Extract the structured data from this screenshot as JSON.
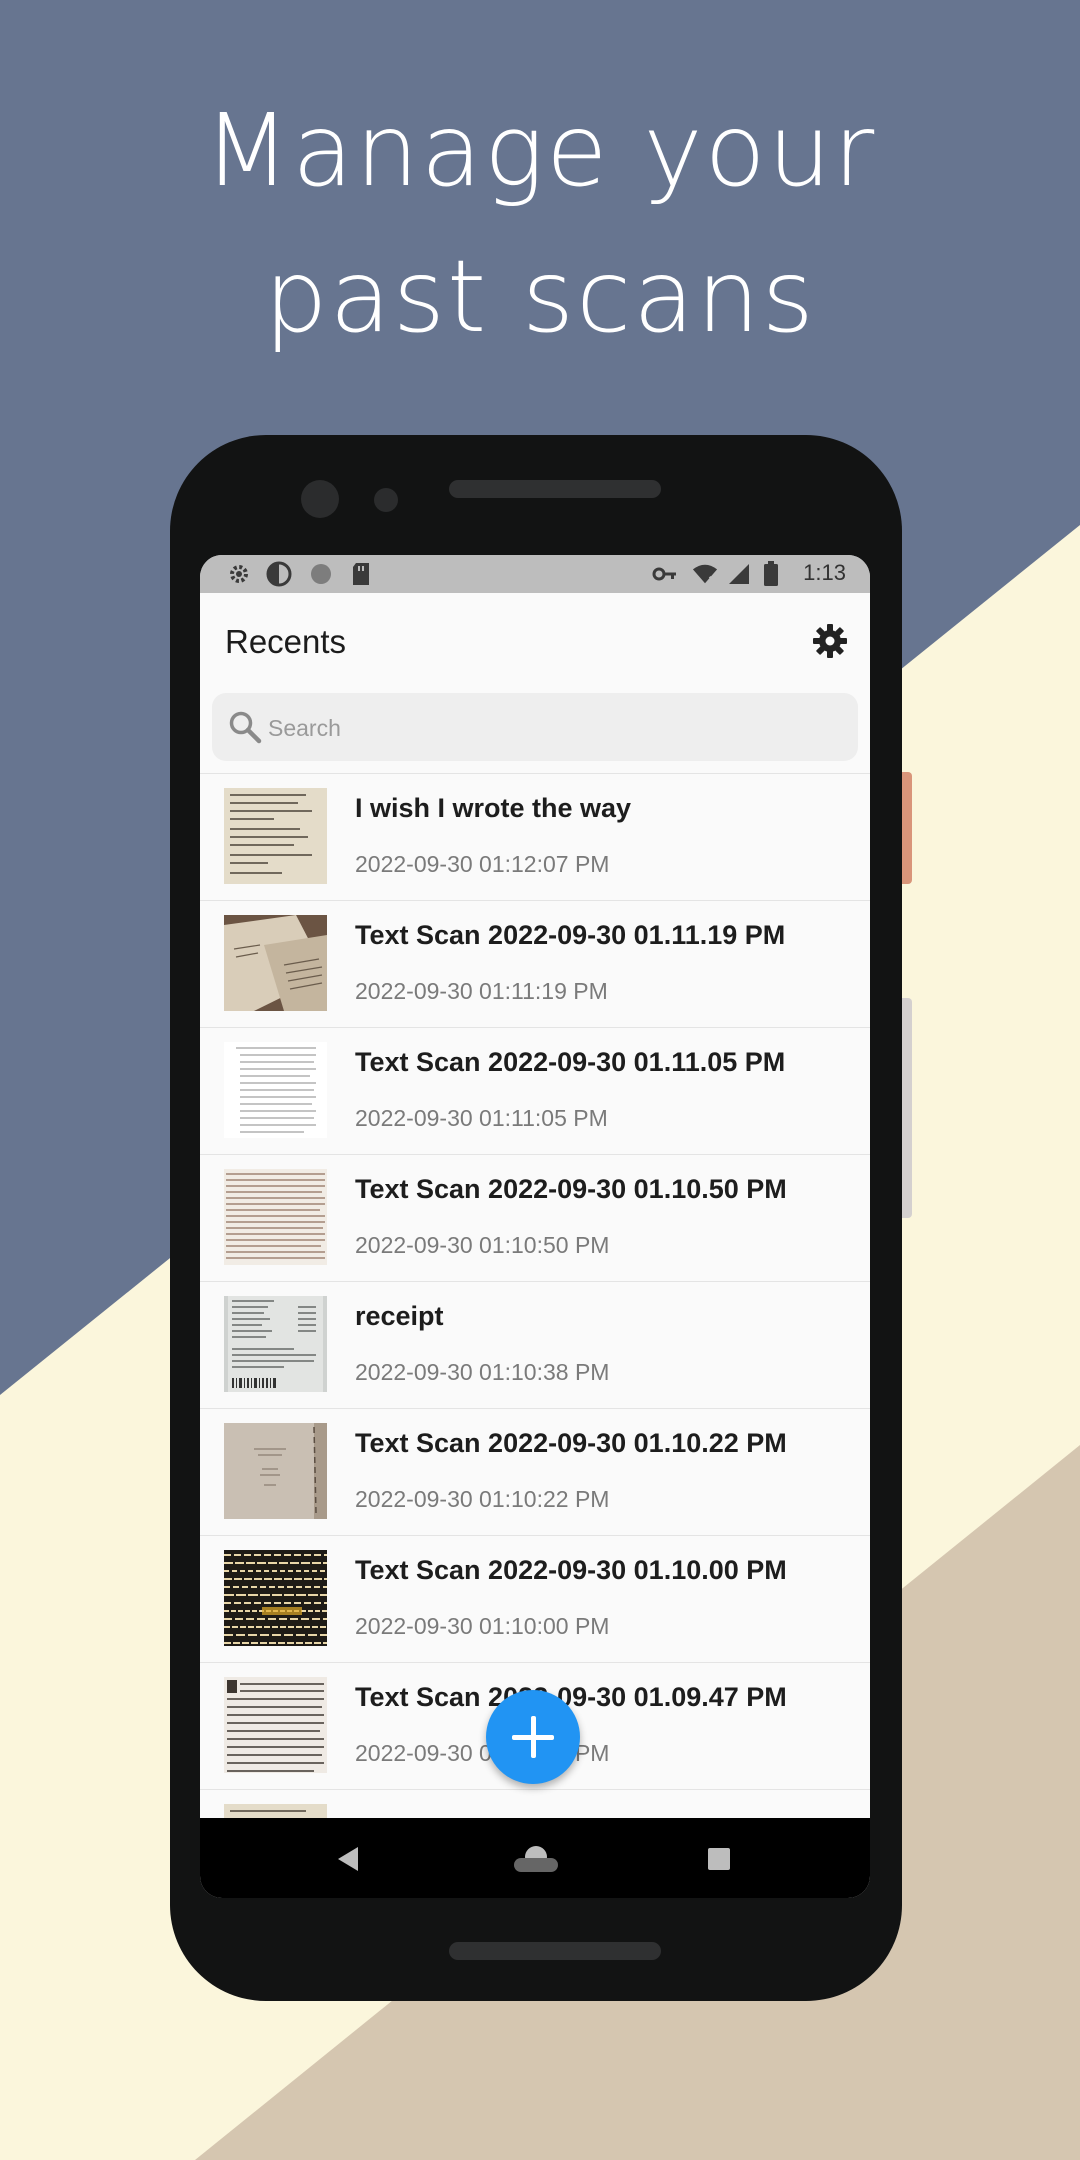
{
  "headline": {
    "line1": "Manage your",
    "line2": "past scans"
  },
  "colors": {
    "background_blue": "#677590",
    "background_cream": "#fbf6dc",
    "background_tan": "#d5c6b0",
    "accent": "#2194f3"
  },
  "statusbar": {
    "left_icons": [
      "gear-icon",
      "contrast-icon",
      "circle-icon",
      "sd-card-icon"
    ],
    "right_icons": [
      "key-icon",
      "wifi-icon",
      "signal-icon",
      "battery-icon"
    ],
    "time": "1:13"
  },
  "appbar": {
    "title": "Recents",
    "settings_icon": "gear-icon"
  },
  "search": {
    "placeholder": "Search",
    "icon": "search-icon"
  },
  "recents": [
    {
      "title": "I wish I wrote the way",
      "date": "2022-09-30 01:12:07 PM"
    },
    {
      "title": "Text Scan 2022-09-30 01.11.19 PM",
      "date": "2022-09-30 01:11:19 PM"
    },
    {
      "title": "Text Scan 2022-09-30 01.11.05 PM",
      "date": "2022-09-30 01:11:05 PM"
    },
    {
      "title": "Text Scan 2022-09-30 01.10.50 PM",
      "date": "2022-09-30 01:10:50 PM"
    },
    {
      "title": "receipt",
      "date": "2022-09-30 01:10:38 PM"
    },
    {
      "title": "Text Scan 2022-09-30 01.10.22 PM",
      "date": "2022-09-30 01:10:22 PM"
    },
    {
      "title": "Text Scan 2022-09-30 01.10.00 PM",
      "date": "2022-09-30 01:10:00 PM"
    },
    {
      "title": "Text Scan 2022-09-30 01.09.47 PM",
      "date": "2022-09-30 01:09:47 PM"
    }
  ],
  "fab": {
    "icon": "plus-icon"
  },
  "navbar": {
    "icons": [
      "back-icon",
      "home-icon",
      "recents-icon"
    ]
  }
}
